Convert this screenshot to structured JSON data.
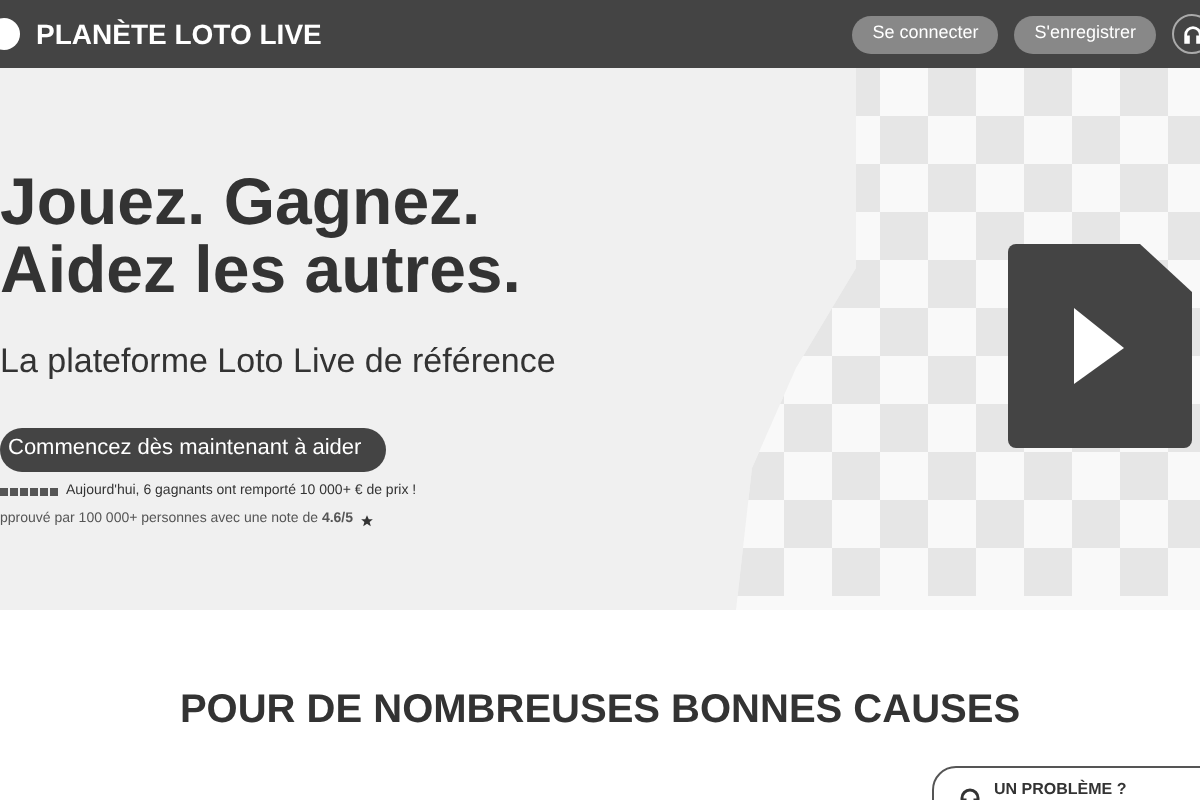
{
  "header": {
    "brand": "PLANÈTE LOTO LIVE",
    "buttons": [
      "Se connecter",
      "S'enregistrer"
    ]
  },
  "hero": {
    "title_lines": [
      "Jouez. Gagnez.",
      "Aidez les autres."
    ],
    "subtitle": "La plateforme Loto Live de référence",
    "cta": "Commencez dès maintenant à aider",
    "stars": 6,
    "winners": "Aujourd'hui, 6 gagnants ont remporté 10 000+ € de prix !",
    "approval": "pprouvé par 100 000+ personnes avec une note de **4.6/5**"
  },
  "section": {
    "heading": "POUR DE NOMBREUSES BONNES CAUSES"
  },
  "help_card": {
    "title": "UN PROBLÈME ?"
  }
}
